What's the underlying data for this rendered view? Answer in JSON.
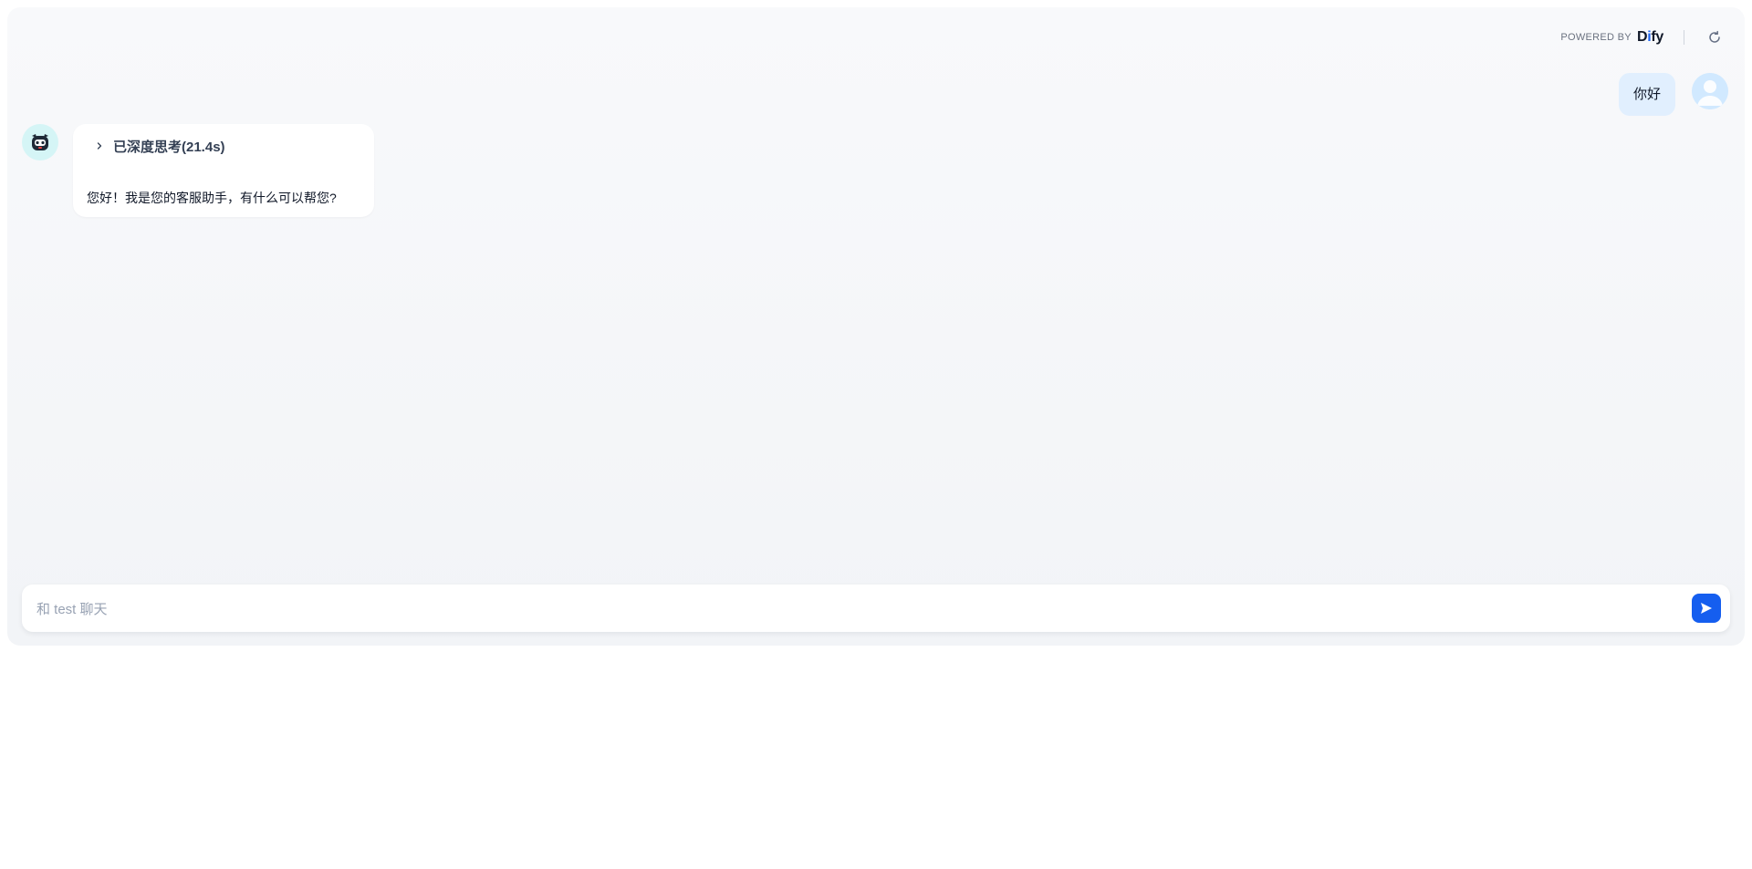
{
  "header": {
    "powered_by": "POWERED BY",
    "brand": {
      "pre": "D",
      "accent": "i",
      "post": "fy"
    },
    "restart_icon": "refresh-icon"
  },
  "messages": {
    "user": {
      "text": "你好",
      "avatar_icon": "user-avatar-icon"
    },
    "bot": {
      "avatar_icon": "robot-avatar-icon",
      "thinking_label": "已深度思考(21.4s)",
      "thinking_icon": "chevron-right-icon",
      "text": "您好！我是您的客服助手，有什么可以帮您?"
    }
  },
  "input": {
    "placeholder": "和 test 聊天",
    "value": "",
    "send_icon": "send-icon"
  },
  "colors": {
    "accent": "#155eef",
    "user_bubble": "#e1effe",
    "bot_avatar_bg": "#d5f5f6"
  }
}
